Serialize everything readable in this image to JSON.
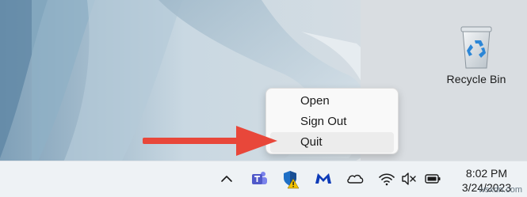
{
  "desktop": {
    "recycle_bin": {
      "label": "Recycle Bin",
      "icon": "recycle-bin-icon"
    }
  },
  "context_menu": {
    "items": [
      {
        "label": "Open"
      },
      {
        "label": "Sign Out"
      },
      {
        "label": "Quit",
        "highlighted": true
      }
    ]
  },
  "annotation": {
    "arrow_color": "#e8473a"
  },
  "taskbar": {
    "tray_icons": [
      "chevron-up-icon",
      "teams-icon",
      "security-shield-warning-icon",
      "malwarebytes-icon",
      "onedrive-cloud-icon",
      "wifi-icon",
      "volume-muted-icon",
      "battery-icon"
    ],
    "clock": {
      "time": "8:02 PM",
      "date": "3/24/2023"
    }
  },
  "watermark": "wsxdn.com"
}
